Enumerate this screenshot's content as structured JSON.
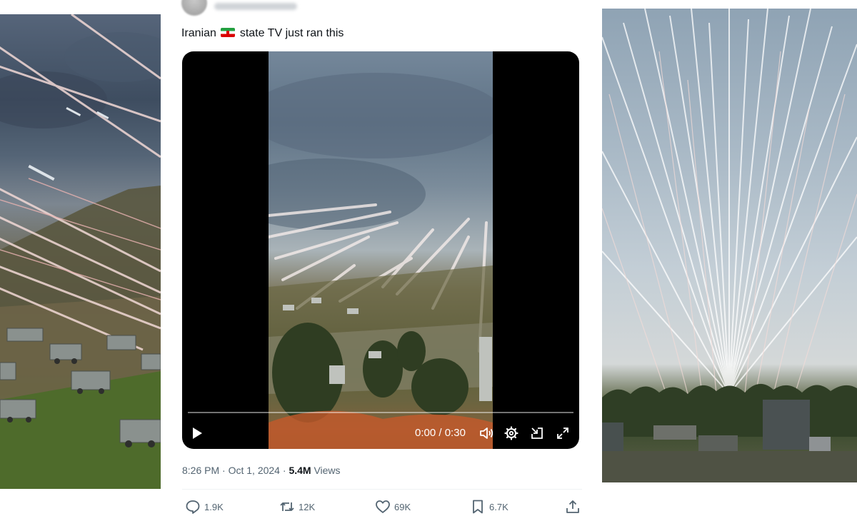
{
  "tweet": {
    "text_before_flag": "Iranian",
    "flag_icon": "iran-flag-emoji",
    "text_after_flag": "state TV just ran this",
    "video": {
      "current_time": "0:00",
      "separator": "/",
      "duration": "0:30",
      "progress": 0
    },
    "meta": {
      "time": "8:26 PM",
      "dot1": "·",
      "date": "Oct 1, 2024",
      "dot2": "·",
      "views_count": "5.4M",
      "views_label": "Views"
    },
    "actions": {
      "replies": "1.9K",
      "reposts": "12K",
      "likes": "69K",
      "bookmarks": "6.7K"
    }
  },
  "colors": {
    "text_primary": "#0f1419",
    "text_secondary": "#536471",
    "flag_green": "#239f40",
    "flag_red": "#da0000"
  }
}
